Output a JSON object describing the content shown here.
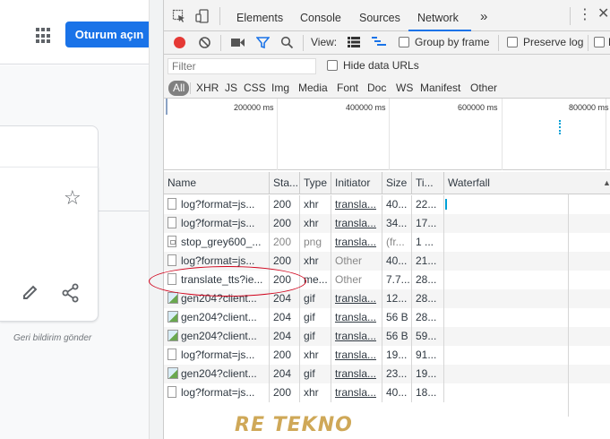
{
  "google": {
    "signin_label": "Oturum açın",
    "feedback_text": "Geri bildirim gönder"
  },
  "devtools": {
    "tabs": [
      "Elements",
      "Console",
      "Sources",
      "Network"
    ],
    "active_tab": "Network",
    "more_tabs": "»",
    "toolbar": {
      "view_label": "View:",
      "group_by_frame": "Group by frame",
      "preserve_log": "Preserve log",
      "truncated": "D"
    },
    "filter": {
      "placeholder": "Filter",
      "hide_data_urls": "Hide data URLs"
    },
    "types": [
      "All",
      "XHR",
      "JS",
      "CSS",
      "Img",
      "Media",
      "Font",
      "Doc",
      "WS",
      "Manifest",
      "Other"
    ],
    "overview_ticks": [
      "200000 ms",
      "400000 ms",
      "600000 ms",
      "800000 ms"
    ],
    "columns": {
      "name": "Name",
      "status": "Sta...",
      "type": "Type",
      "initiator": "Initiator",
      "size": "Size",
      "time": "Ti...",
      "waterfall": "Waterfall"
    },
    "rows": [
      {
        "name": "log?format=js...",
        "status": "200",
        "type": "xhr",
        "initiator": "transla...",
        "size": "40...",
        "time": "22...",
        "icon": "doc"
      },
      {
        "name": "log?format=js...",
        "status": "200",
        "type": "xhr",
        "initiator": "transla...",
        "size": "34...",
        "time": "17...",
        "icon": "doc"
      },
      {
        "name": "stop_grey600_...",
        "status": "200",
        "type": "png",
        "initiator": "transla...",
        "size": "(fr...",
        "time": "1 ...",
        "icon": "png"
      },
      {
        "name": "log?format=js...",
        "status": "200",
        "type": "xhr",
        "initiator": "Other",
        "size": "40...",
        "time": "21...",
        "icon": "doc"
      },
      {
        "name": "translate_tts?ie...",
        "status": "200",
        "type": "me...",
        "initiator": "Other",
        "size": "7.7...",
        "time": "28...",
        "icon": "doc"
      },
      {
        "name": "gen204?client...",
        "status": "204",
        "type": "gif",
        "initiator": "transla...",
        "size": "12...",
        "time": "28...",
        "icon": "img"
      },
      {
        "name": "gen204?client...",
        "status": "204",
        "type": "gif",
        "initiator": "transla...",
        "size": "56 B",
        "time": "28...",
        "icon": "img"
      },
      {
        "name": "gen204?client...",
        "status": "204",
        "type": "gif",
        "initiator": "transla...",
        "size": "56 B",
        "time": "59...",
        "icon": "img"
      },
      {
        "name": "log?format=js...",
        "status": "200",
        "type": "xhr",
        "initiator": "transla...",
        "size": "19...",
        "time": "91...",
        "icon": "doc"
      },
      {
        "name": "gen204?client...",
        "status": "204",
        "type": "gif",
        "initiator": "transla...",
        "size": "23...",
        "time": "19...",
        "icon": "img"
      },
      {
        "name": "log?format=js...",
        "status": "200",
        "type": "xhr",
        "initiator": "transla...",
        "size": "40...",
        "time": "18...",
        "icon": "doc"
      }
    ]
  },
  "watermark": "RE TEKNO",
  "colors": {
    "accent_blue": "#1a73e8",
    "record_red": "#e53935",
    "highlight_ellipse": "#d0021b",
    "watermark": "#c79a3b"
  }
}
